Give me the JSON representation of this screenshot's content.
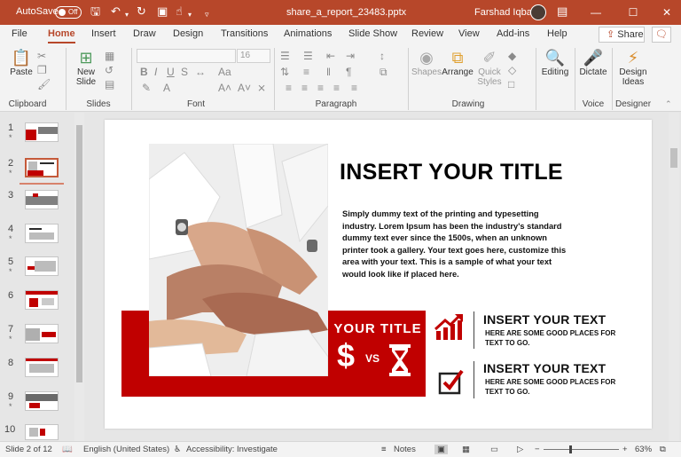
{
  "titlebar": {
    "autosave_label": "AutoSave",
    "autosave_state": "Off",
    "filename": "share_a_report_23483.pptx",
    "user": "Farshad Iqbal"
  },
  "tabs": [
    "File",
    "Home",
    "Insert",
    "Draw",
    "Design",
    "Transitions",
    "Animations",
    "Slide Show",
    "Review",
    "View",
    "Add-ins",
    "Help"
  ],
  "share_label": "Share",
  "ribbon": {
    "paste": "Paste",
    "new_slide": "New",
    "new_slide_2": "Slide",
    "font_size": "16",
    "shapes": "Shapes",
    "arrange": "Arrange",
    "quick_styles": "Quick",
    "quick_styles_2": "Styles",
    "editing": "Editing",
    "dictate": "Dictate",
    "design_ideas": "Design",
    "design_ideas_2": "Ideas",
    "groups": [
      "Clipboard",
      "Slides",
      "Font",
      "Paragraph",
      "Drawing",
      "Voice",
      "Designer"
    ]
  },
  "thumbnails": [
    {
      "num": "1",
      "star": "*"
    },
    {
      "num": "2",
      "star": "*"
    },
    {
      "num": "3",
      "star": ""
    },
    {
      "num": "4",
      "star": "*"
    },
    {
      "num": "5",
      "star": "*"
    },
    {
      "num": "6",
      "star": ""
    },
    {
      "num": "7",
      "star": "*"
    },
    {
      "num": "8",
      "star": ""
    },
    {
      "num": "9",
      "star": "*"
    },
    {
      "num": "10",
      "star": ""
    }
  ],
  "selected_slide": 2,
  "slide": {
    "title": "INSERT YOUR TITLE",
    "body": "Simply dummy text of the printing and typesetting industry.  Lorem Ipsum has been the industry's standard dummy text ever since the 1500s, when an unknown printer took a gallery. Your text goes here, customize this area with your text. This is a sample of what your text would look like if placed here.",
    "band_title": "YOUR TITLE",
    "dollar": "$",
    "vs": "VS",
    "features": [
      {
        "title": "INSERT YOUR TEXT",
        "sub1": "HERE ARE SOME GOOD PLACES FOR",
        "sub2": "TEXT TO GO.",
        "icon": "chart-up-icon"
      },
      {
        "title": "INSERT YOUR TEXT",
        "sub1": "HERE ARE SOME GOOD PLACES FOR",
        "sub2": "TEXT TO GO.",
        "icon": "checkbox-icon"
      }
    ]
  },
  "statusbar": {
    "slide_info": "Slide 2 of 12",
    "language": "English (United States)",
    "accessibility": "Accessibility: Investigate",
    "notes": "Notes",
    "zoom": "63%"
  },
  "colors": {
    "accent": "#b7472a",
    "slide_red": "#c00000"
  }
}
